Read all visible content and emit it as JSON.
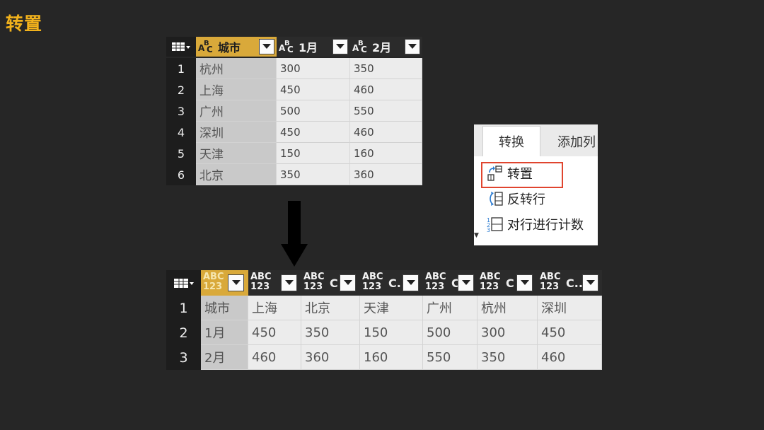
{
  "title": "转置",
  "before_table": {
    "columns": [
      "城市",
      "1月",
      "2月"
    ],
    "rows": [
      {
        "n": "1",
        "city": "杭州",
        "m1": "300",
        "m2": "350"
      },
      {
        "n": "2",
        "city": "上海",
        "m1": "450",
        "m2": "460"
      },
      {
        "n": "3",
        "city": "广州",
        "m1": "500",
        "m2": "550"
      },
      {
        "n": "4",
        "city": "深圳",
        "m1": "450",
        "m2": "460"
      },
      {
        "n": "5",
        "city": "天津",
        "m1": "150",
        "m2": "160"
      },
      {
        "n": "6",
        "city": "北京",
        "m1": "350",
        "m2": "360"
      }
    ]
  },
  "ribbon": {
    "tabs": [
      "转换",
      "添加列"
    ],
    "commands": [
      "转置",
      "反转行",
      "对行进行计数"
    ]
  },
  "after_table": {
    "header_fragments": [
      "",
      "",
      "C",
      "C",
      "C.",
      "C",
      "C",
      "C.."
    ],
    "rows": [
      {
        "n": "1",
        "cells": [
          "城市",
          "上海",
          "北京",
          "天津",
          "广州",
          "杭州",
          "深圳"
        ]
      },
      {
        "n": "2",
        "cells": [
          "1月",
          "450",
          "350",
          "150",
          "500",
          "300",
          "450"
        ]
      },
      {
        "n": "3",
        "cells": [
          "2月",
          "460",
          "360",
          "160",
          "550",
          "350",
          "460"
        ]
      }
    ]
  },
  "colors": {
    "background": "#262626",
    "title": "#f2b21c",
    "selected_header": "#d9a93a",
    "highlight_border": "#e0452f"
  }
}
